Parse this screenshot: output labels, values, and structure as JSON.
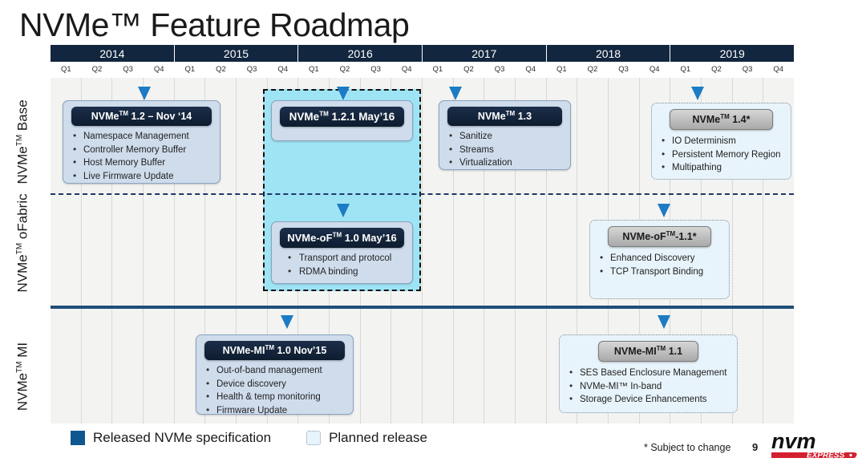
{
  "title": "NVMe™ Feature Roadmap",
  "timeline": {
    "years": [
      "2014",
      "2015",
      "2016",
      "2017",
      "2018",
      "2019"
    ],
    "quarters": [
      "Q1",
      "Q2",
      "Q3",
      "Q4",
      "Q1",
      "Q2",
      "Q3",
      "Q4",
      "Q1",
      "Q2",
      "Q3",
      "Q4",
      "Q1",
      "Q2",
      "Q3",
      "Q4",
      "Q1",
      "Q2",
      "Q3",
      "Q4",
      "Q1",
      "Q2",
      "Q3",
      "Q4"
    ]
  },
  "rows": [
    {
      "label_line1": "NVMe",
      "label_line2": "Base",
      "label_tm": "TM"
    },
    {
      "label_line1": "NVMe",
      "label_line2": "oFabric",
      "label_tm": "TM"
    },
    {
      "label_line1": "NVMe",
      "label_line2": "MI",
      "label_tm": "TM"
    }
  ],
  "boxes": {
    "nvme_12": {
      "title_pre": "NVMe",
      "title_tm": "TM",
      "title_post": " 1.2 – Nov ‘14",
      "status": "released",
      "bullets": [
        "Namespace Management",
        "Controller Memory Buffer",
        "Host Memory Buffer",
        "Live Firmware Update"
      ]
    },
    "nvme_121": {
      "title_pre": "NVMe",
      "title_tm": "TM",
      "title_post": " 1.2.1 May’16",
      "status": "released",
      "bullets": []
    },
    "nvme_13": {
      "title_pre": "NVMe",
      "title_tm": "TM",
      "title_post": " 1.3",
      "status": "released",
      "bullets": [
        "Sanitize",
        "Streams",
        "Virtualization"
      ]
    },
    "nvme_14": {
      "title_pre": "NVMe",
      "title_tm": "TM",
      "title_post": " 1.4*",
      "status": "planned",
      "bullets": [
        "IO Determinism",
        "Persistent Memory Region",
        "Multipathing"
      ]
    },
    "nvmeof_10": {
      "title_pre": "NVMe-oF",
      "title_tm": "TM",
      "title_post": " 1.0 May’16",
      "status": "released",
      "bullets": [
        "Transport and protocol",
        "RDMA binding"
      ]
    },
    "nvmeof_11": {
      "title_pre": "NVMe-oF",
      "title_tm": "TM",
      "title_post": "-1.1*",
      "status": "planned",
      "bullets": [
        "Enhanced Discovery",
        "TCP Transport Binding"
      ]
    },
    "nvmemi_10": {
      "title_pre": "NVMe-MI",
      "title_tm": "TM",
      "title_post": " 1.0  Nov’15",
      "status": "released",
      "bullets": [
        "Out-of-band management",
        "Device discovery",
        "Health & temp monitoring",
        "Firmware Update"
      ]
    },
    "nvmemi_11": {
      "title_pre": "NVMe-MI",
      "title_tm": "TM",
      "title_post": " 1.1",
      "status": "planned",
      "bullets": [
        "SES Based Enclosure Management",
        "NVMe-MI™ In-band",
        "Storage Device Enhancements"
      ]
    }
  },
  "legend": {
    "released_label": "Released NVMe specification",
    "planned_label": "Planned release"
  },
  "footer": {
    "subject_note": "* Subject to change",
    "page_number": "9",
    "logo_main": "nvm",
    "logo_sub": "EXPRESS"
  },
  "colors": {
    "header_navy": "#12263f",
    "box_dark_header": "#14253c",
    "released_fill": "#cfdcec",
    "planned_fill": "#e8f4fb",
    "highlight_fill": "#9fe4f5",
    "marker_blue": "#1c7bc4",
    "legend_swatch": "#11578f",
    "logo_red": "#d32030"
  }
}
